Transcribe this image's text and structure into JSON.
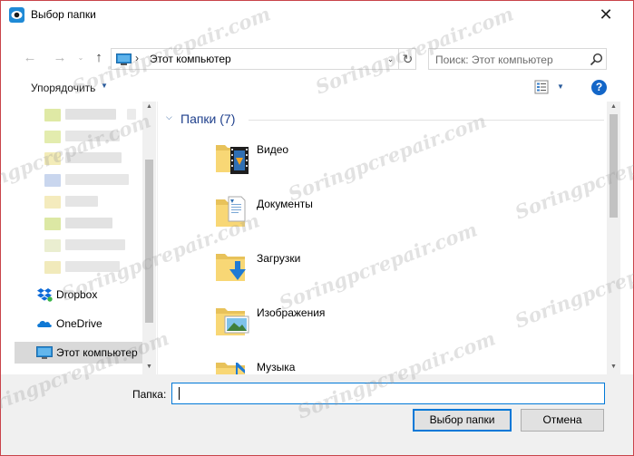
{
  "window": {
    "title": "Выбор папки",
    "close_glyph": "✕"
  },
  "nav": {
    "back_glyph": "←",
    "forward_glyph": "→",
    "recent_glyph": "⌄",
    "up_glyph": "↑",
    "address_separator": "›",
    "address_text": "Этот компьютер",
    "address_dropdown_glyph": "⌄",
    "refresh_glyph": "↻",
    "search_placeholder": "Поиск: Этот компьютер"
  },
  "toolbar": {
    "organize_label": "Упорядочить",
    "organize_arrow": "▼",
    "view_arrow": "▼",
    "help_label": "?"
  },
  "sidebar": {
    "items": [
      {
        "label": "Dropbox",
        "icon": "dropbox-icon"
      },
      {
        "label": "OneDrive",
        "icon": "onedrive-icon"
      },
      {
        "label": "Этот компьютер",
        "icon": "computer-icon",
        "selected": true
      }
    ],
    "scroll_up": "▲",
    "scroll_down": "▼"
  },
  "main": {
    "group_chevron": "⌵",
    "group_title": "Папки (7)",
    "folders": [
      {
        "label": "Видео",
        "icon": "video-folder-icon"
      },
      {
        "label": "Документы",
        "icon": "documents-folder-icon"
      },
      {
        "label": "Загрузки",
        "icon": "downloads-folder-icon"
      },
      {
        "label": "Изображения",
        "icon": "pictures-folder-icon"
      },
      {
        "label": "Музыка",
        "icon": "music-folder-icon"
      }
    ],
    "scroll_up": "▲",
    "scroll_down": "▼"
  },
  "bottom": {
    "folder_label": "Папка:",
    "folder_value": "",
    "select_button": "Выбор папки",
    "cancel_button": "Отмена"
  },
  "watermark": "Soringpcrepair.com",
  "colors": {
    "accent": "#0078d7",
    "window_border": "#c9434a",
    "group_title": "#1e3f8c",
    "folder_yellow": "#f8d775"
  }
}
